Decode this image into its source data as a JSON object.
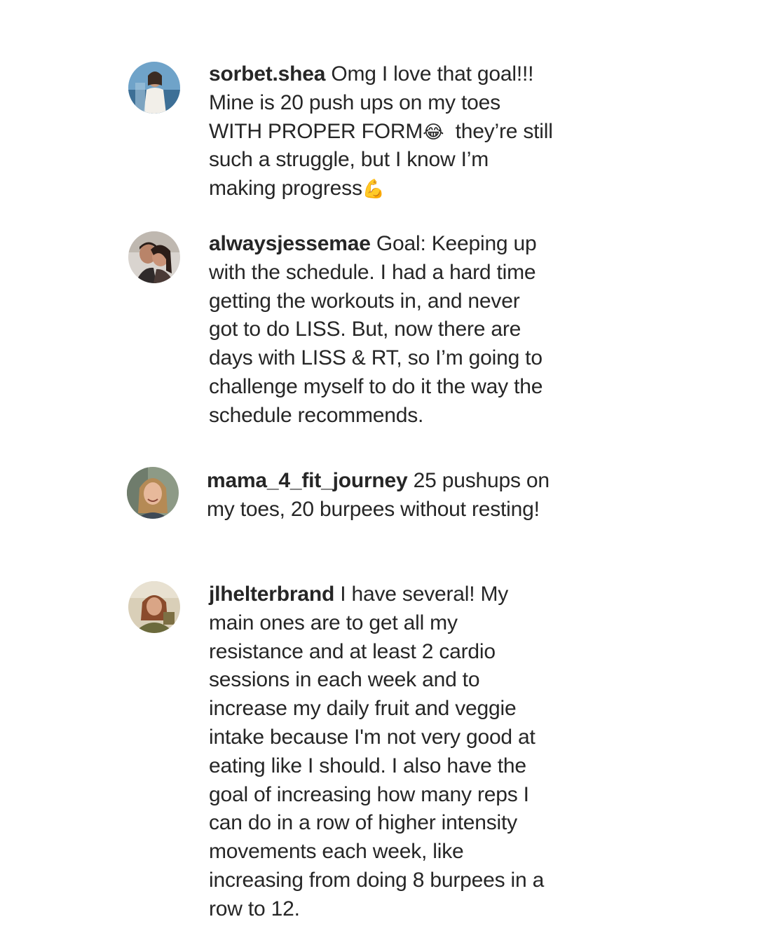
{
  "comments": [
    {
      "username": "sorbet.shea",
      "lines": [
        "Omg I love that goal!!!",
        "Mine is 20 push ups on my toes",
        "WITH PROPER FORM",
        "they’re still",
        "such a struggle, but I know I’m",
        "making progress"
      ],
      "emoji_laugh": "😂",
      "emoji_muscle": "💪"
    },
    {
      "username": "alwaysjessemae",
      "lines": [
        "Goal: Keeping up",
        "with the schedule. I had a hard time",
        "getting the workouts in, and never",
        "got to do LISS. But, now there are",
        "days with LISS & RT, so I’m going to",
        "challenge myself to do it the way the",
        "schedule recommends."
      ]
    },
    {
      "username": "mama_4_fit_journey",
      "lines": [
        "25 pushups on",
        "my toes, 20 burpees without resting!"
      ]
    },
    {
      "username": "jlhelterbrand",
      "lines": [
        "I have several! My",
        "main ones are to get all my",
        "resistance and at least 2 cardio",
        "sessions in each week and to",
        "increase my daily fruit and veggie",
        "intake because I'm not very good at",
        "eating like I should. I also have the",
        "goal of increasing how many reps I",
        "can do in a row of higher intensity",
        "movements each week, like",
        "increasing from doing 8 burpees in a",
        "row to 12."
      ]
    }
  ]
}
